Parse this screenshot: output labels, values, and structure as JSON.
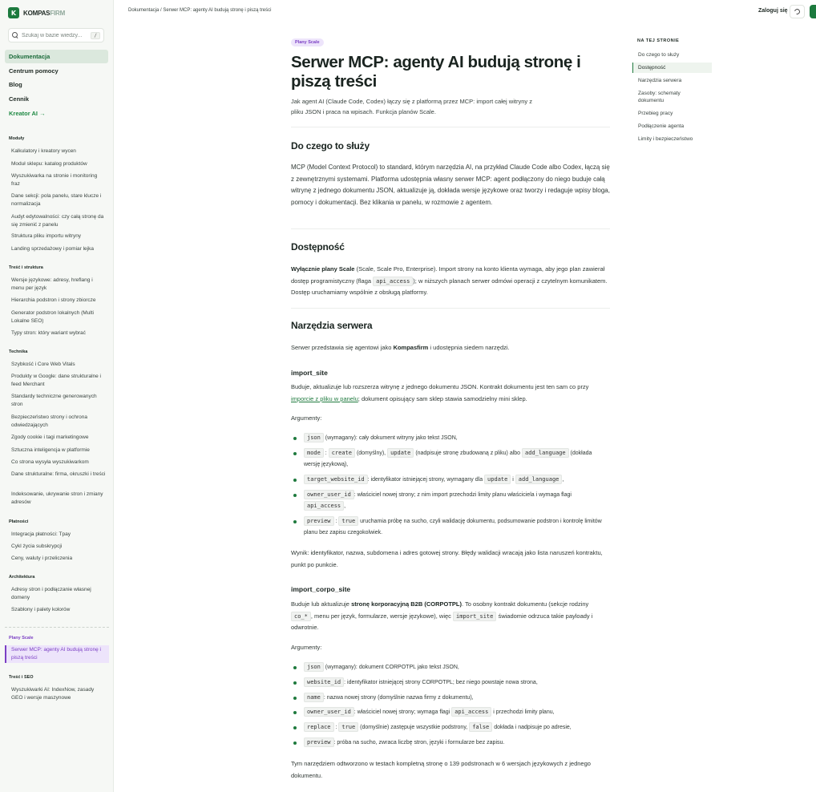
{
  "brand": {
    "name_a": "KOMPAS",
    "name_b": "FIRM",
    "mark": "K"
  },
  "search": {
    "placeholder": "Szukaj w bazie wiedzy...",
    "kbd": "/"
  },
  "nav": {
    "docs": "Dokumentacja",
    "help": "Centrum pomocy",
    "blog": "Blog",
    "pricing": "Cennik",
    "creator": "Kreator AI →"
  },
  "sidebar": {
    "sections": [
      {
        "title": "Moduły",
        "items": [
          "Kalkulatory i kreatory wycen",
          "Moduł sklepu: katalog produktów",
          "Wyszukiwarka na stronie i monitoring fraz",
          "Dane sekcji: pola panelu, stare klucze i normalizacja",
          "Audyt edytowalności: czy całą stronę da się zmienić z panelu",
          "Struktura pliku importu witryny",
          "Landing sprzedażowy i pomiar lejka"
        ]
      },
      {
        "title": "Treść i struktura",
        "items": [
          "Wersje językowe: adresy, hreflang i menu per język",
          "Hierarchia podstron i strony zbiorcze",
          "Generator podstron lokalnych (Multi Lokalne SEO)",
          "Typy stron: który wariant wybrać"
        ]
      },
      {
        "title": "Technika",
        "items": [
          "Szybkość i Core Web Vitals",
          "Produkty w Google: dane strukturalne i feed Merchant",
          "Standardy techniczne generowanych stron",
          "Bezpieczeństwo strony i ochrona odwiedzających",
          "Zgody cookie i tagi marketingowe",
          "Sztuczna inteligencja w platformie",
          "Co strona wysyła wyszukiwarkom",
          "Dane strukturalne: firma, okruszki i treści",
          "Indeksowanie, ukrywanie stron i zmiany adresów"
        ]
      },
      {
        "title": "Płatności",
        "items": [
          "Integracja płatności: Tpay",
          "Cykl życia subskrypcji",
          "Ceny, waluty i przeliczenia"
        ]
      },
      {
        "title": "Architektura",
        "items": [
          "Adresy stron i podłączanie własnej domeny",
          "Szablony i palety kolorów"
        ]
      },
      {
        "title": "Plany Scale",
        "items": [
          "Serwer MCP: agenty AI budują stronę i piszą treści"
        ]
      },
      {
        "title": "Treść i SEO",
        "items": [
          "Wyszukiwarki AI: IndexNow, zasady GEO i wersje maszynowe"
        ]
      }
    ]
  },
  "topbar": {
    "breadcrumb": "Dokumentacja / Serwer MCP: agenty AI budują stronę i piszą treści",
    "login": "Zaloguj się"
  },
  "article": {
    "badge": "Plany Scale",
    "title": "Serwer MCP: agenty AI budują stronę i piszą treści",
    "lede": "Jak agent AI (Claude Code, Codex) łączy się z platformą przez MCP: import całej witryny z pliku JSON i praca na wpisach. Funkcja planów Scale.",
    "h_purpose": "Do czego to służy",
    "p_purpose": "MCP (Model Context Protocol) to standard, którym narzędzia AI, na przykład Claude Code albo Codex, łączą się z zewnętrznymi systemami. Platforma udostępnia własny serwer MCP: agent podłączony do niego buduje całą witrynę z jednego dokumentu JSON, aktualizuje ją, dokłada wersje językowe oraz tworzy i redaguje wpisy bloga, pomocy i dokumentacji. Bez klikania w panelu, w rozmowie z agentem.",
    "h_avail": "Dostępność",
    "avail_b": "Wyłącznie plany Scale",
    "avail_1": " (Scale, Scale Pro, Enterprise). Import strony na konto klienta wymaga, aby jego plan zawierał dostęp programistyczny (flaga ",
    "avail_code": "api_access",
    "avail_2": "); w niższych planach serwer odmówi operacji z czytelnym komunikatem. Dostęp uruchamiamy wspólnie z obsługą platformy.",
    "h_tools": "Narzędzia serwera",
    "tools_1": "Serwer przedstawia się agentowi jako ",
    "tools_b": "Kompasfirm",
    "tools_2": " i udostępnia siedem narzędzi.",
    "h_import": "import_site",
    "import_1": "Buduje, aktualizuje lub rozszerza witrynę z jednego dokumentu JSON. Kontrakt dokumentu jest ten sam co przy ",
    "import_link": "imporcie z pliku w panelu",
    "import_2": "; dokument opisujący sam sklep stawia samodzielny mini sklep.",
    "args": "Argumenty:",
    "import_args": [
      {
        "c": [
          "json"
        ],
        "t": [
          "",
          " (wymagany): cały dokument witryny jako tekst JSON,"
        ]
      },
      {
        "c": [
          "mode",
          "create",
          "update",
          "add_language"
        ],
        "t": [
          "",
          " : ",
          ", ",
          "(domyślny), ",
          " (nadpisuje stronę zbudowaną z pliku) albo ",
          " (dokłada wersję językową),"
        ]
      },
      {
        "c": [
          "target_website_id",
          "update",
          "add_language"
        ],
        "t": [
          "",
          ": identyfikator istniejącej strony, wymagany dla ",
          " i ",
          ","
        ]
      },
      {
        "c": [
          "owner_user_id",
          "api_access"
        ],
        "t": [
          "",
          ": właściciel nowej strony; z nim import przechodzi limity planu właściciela i wymaga flagi ",
          ","
        ]
      },
      {
        "c": [
          "preview",
          "true"
        ],
        "t": [
          "",
          " : ",
          " uruchamia próbę na sucho, czyli walidację dokumentu, podsumowanie podstron i kontrolę limitów planu bez zapisu czegokolwiek."
        ]
      }
    ],
    "import_result": "Wynik: identyfikator, nazwa, subdomena i adres gotowej strony. Błędy walidacji wracają jako lista naruszeń kontraktu, punkt po punkcie.",
    "h_corpo": "import_corpo_site",
    "corpo_1": "Buduje lub aktualizuje ",
    "corpo_b": "stronę korporacyjną B2B (CORPOTPL)",
    "corpo_2": ". To osobny kontrakt dokumentu (sekcje rodziny ",
    "corpo_c1": "co_*",
    "corpo_3": ", menu per język, formularze, wersje językowe), więc ",
    "corpo_c2": "import_site",
    "corpo_4": " świadomie odrzuca takie payloady i odwrotnie.",
    "corpo_args": [
      {
        "c": [
          "json"
        ],
        "t": [
          "",
          " (wymagany): dokument CORPOTPL jako tekst JSON,"
        ]
      },
      {
        "c": [
          "website_id"
        ],
        "t": [
          "",
          ": identyfikator istniejącej strony CORPOTPL; bez niego powstaje nowa strona,"
        ]
      },
      {
        "c": [
          "name"
        ],
        "t": [
          "",
          ": nazwa nowej strony (domyślnie nazwa firmy z dokumentu),"
        ]
      },
      {
        "c": [
          "owner_user_id",
          "api_access"
        ],
        "t": [
          "",
          ": właściciel nowej strony; wymaga flagi ",
          " i przechodzi limity planu,"
        ]
      },
      {
        "c": [
          "replace",
          "true",
          "false"
        ],
        "t": [
          "",
          " : ",
          " (domyślnie) zastępuje wszystkie podstrony, ",
          " dokłada i nadpisuje po adresie,"
        ]
      },
      {
        "c": [
          "preview"
        ],
        "t": [
          "",
          ": próba na sucho, zwraca liczbę stron, języki i formularze bez zapisu."
        ]
      }
    ],
    "corpo_result": "Tym narzędziem odtworzono w testach kompletną stronę o 139 podstronach w 6 wersjach językowych z jednego dokumentu."
  },
  "toc": {
    "title": "NA TEJ STRONIE",
    "items": [
      "Do czego to służy",
      "Dostępność",
      "Narzędzia serwera",
      "Zasoby: schematy dokumentu",
      "Przebieg pracy",
      "Podłączenie agenta",
      "Limity i bezpieczeństwo"
    ]
  },
  "colors": {
    "accent": "#1c7a3e",
    "purple": "#7b3fc4"
  }
}
